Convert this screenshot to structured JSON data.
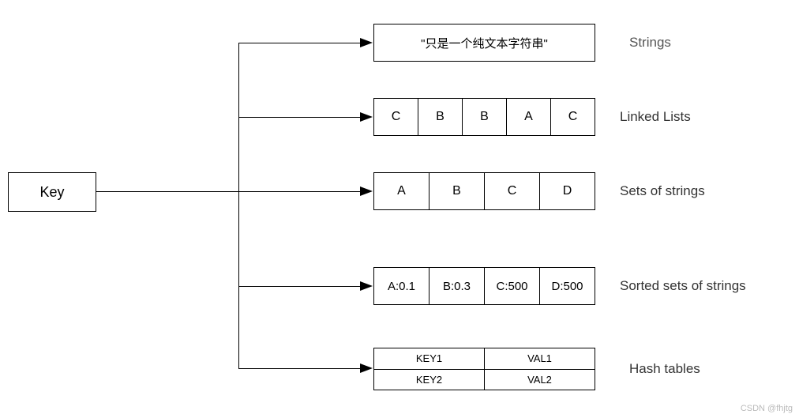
{
  "key_label": "Key",
  "rows": {
    "strings": {
      "text": "\"只是一个纯文本字符串\"",
      "label": "Strings"
    },
    "linked_lists": {
      "cells": [
        "C",
        "B",
        "B",
        "A",
        "C"
      ],
      "label": "Linked Lists"
    },
    "sets": {
      "cells": [
        "A",
        "B",
        "C",
        "D"
      ],
      "label": "Sets of strings"
    },
    "sorted_sets": {
      "cells": [
        "A:0.1",
        "B:0.3",
        "C:500",
        "D:500"
      ],
      "label": "Sorted sets of strings"
    },
    "hash": {
      "keys": [
        "KEY1",
        "KEY2"
      ],
      "vals": [
        "VAL1",
        "VAL2"
      ],
      "label": "Hash tables"
    }
  },
  "watermark": "CSDN @fhjtg"
}
